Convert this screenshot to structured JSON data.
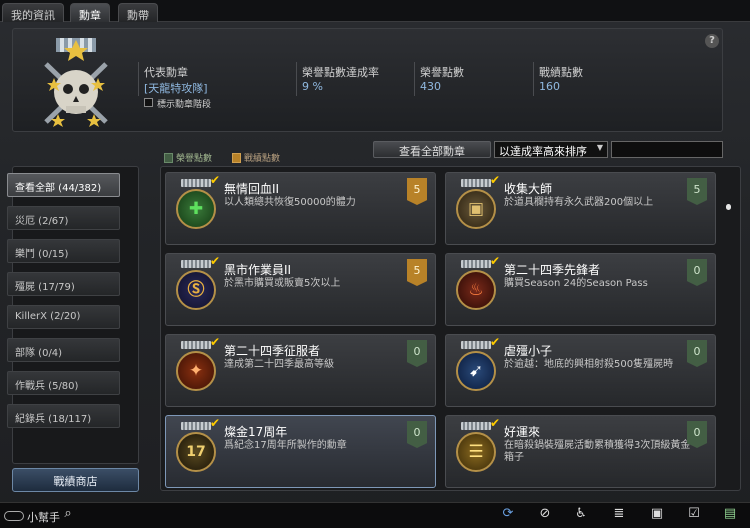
{
  "tabs": [
    {
      "label": "我的資訊"
    },
    {
      "label": "勳章"
    },
    {
      "label": "勳帶"
    }
  ],
  "profile": {
    "representative_label": "代表勳章",
    "representative_value": "[天龍特攻隊]",
    "show_stage_label": "標示勳章階段",
    "rate_label": "榮譽點數達成率",
    "rate_value": "9 %",
    "honor_label": "榮譽點數",
    "honor_value": "430",
    "battle_label": "戰績點數",
    "battle_value": "160",
    "help": "?"
  },
  "legend": {
    "honor": "榮譽點數",
    "battle": "戰績點數"
  },
  "toolbar": {
    "view_all": "查看全部勳章",
    "sort_value": "以達成率高來排序"
  },
  "sidebar": {
    "items": [
      {
        "label": "查看全部 (44/382)"
      },
      {
        "label": "災厄 (2/67)"
      },
      {
        "label": "樂鬥 (0/15)"
      },
      {
        "label": "殭屍 (17/79)"
      },
      {
        "label": "KillerX (2/20)"
      },
      {
        "label": "部隊 (0/4)"
      },
      {
        "label": "作戰兵 (5/80)"
      },
      {
        "label": "紀錄兵 (18/117)"
      }
    ],
    "shop": "戰績商店"
  },
  "cards": [
    {
      "title": "無情回血II",
      "desc": "以人類總共恢復50000的體力",
      "points": "5",
      "icon": "plus-icon"
    },
    {
      "title": "收集大師",
      "desc": "於道具欄持有永久武器200個以上",
      "points": "5",
      "icon": "chest-icon"
    },
    {
      "title": "黑市作業員II",
      "desc": "於黑市購買或販賣5次以上",
      "points": "5",
      "icon": "coin-icon"
    },
    {
      "title": "第二十四季先鋒者",
      "desc": "購買Season 24的Season Pass",
      "points": "0",
      "icon": "flame-icon"
    },
    {
      "title": "第二十四季征服者",
      "desc": "達成第二十四季最高等級",
      "points": "0",
      "icon": "soldier-icon"
    },
    {
      "title": "虐殭小子",
      "desc": "於逾越：地底的興相射殺500隻殭屍時",
      "points": "0",
      "icon": "runner-icon"
    },
    {
      "title": "燦金17周年",
      "desc": "爲紀念17周年所製作的勳章",
      "points": "0",
      "icon": "anniversary-icon",
      "medal_text": "17"
    },
    {
      "title": "好運來",
      "desc": "在暗殺鍋裝殭屍活動累積獲得3次頂級黃金箱子",
      "points": "0",
      "icon": "gold-bar-icon"
    }
  ],
  "bottom": {
    "helper": "小幫手"
  },
  "colors": {
    "gold": "#b88228",
    "green": "#435e44",
    "accent": "#8fb8e0"
  }
}
